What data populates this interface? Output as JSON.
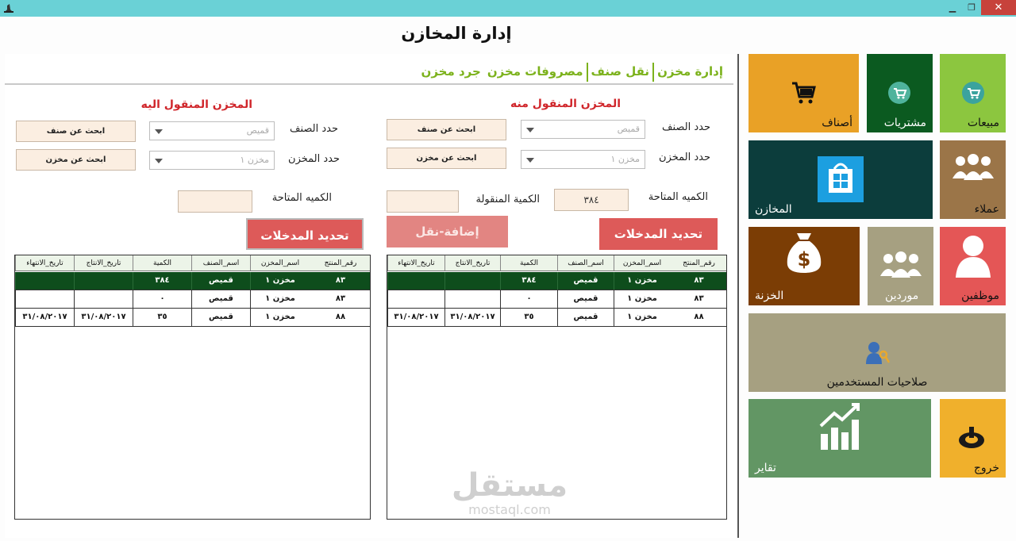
{
  "window": {
    "title_icon": "witch-hat-icon",
    "minimize": "▁",
    "maximize": "❐",
    "close": "✕"
  },
  "page": {
    "title": "إدارة المخازن"
  },
  "tabs": [
    "إدارة مخزن",
    "نقل صنف",
    "مصروفات مخزن",
    "جرد مخزن"
  ],
  "from_section": {
    "heading": "المخزن المنقول منه",
    "item_label": "حدد الصنف",
    "item_value": "قميص",
    "item_search": "ابحث عن صنف",
    "store_label": "حدد المخزن",
    "store_value": "مخزن ١",
    "store_search": "ابحث عن مخزن",
    "available_label": "الكميه المتاحة",
    "available_value": "٣٨٤",
    "moved_label": "الكمية المنقولة",
    "moved_value": "",
    "add_button": "إضافة-نقل",
    "refresh_button": "تحديد المدخلات"
  },
  "to_section": {
    "heading": "المخزن المنقول اليه",
    "item_label": "حدد الصنف",
    "item_value": "قميص",
    "item_search": "ابحث عن صنف",
    "store_label": "حدد المخزن",
    "store_value": "مخزن ١",
    "store_search": "ابحث عن مخزن",
    "available_label": "الكميه المتاحة",
    "available_value": "",
    "refresh_button": "تحديد المدخلات"
  },
  "grid_columns": [
    "رقم_المنتج",
    "اسم_المخزن",
    "اسم_الصنف",
    "الكمية",
    "تاريخ_الانتاج",
    "تاريخ_الانتهاء"
  ],
  "from_grid": {
    "rows": [
      [
        "٨٣",
        "مخزن ١",
        "قميص",
        "٣٨٤",
        "",
        ""
      ],
      [
        "٨٣",
        "مخزن ١",
        "قميص",
        "٠",
        "",
        ""
      ],
      [
        "٨٨",
        "مخزن ١",
        "قميص",
        "٣٥",
        "٣١/٠٨/٢٠١٧",
        "٣١/٠٨/٢٠١٧"
      ]
    ]
  },
  "to_grid": {
    "rows": [
      [
        "٨٣",
        "مخزن ١",
        "قميص",
        "٣٨٤",
        "",
        ""
      ],
      [
        "٨٣",
        "مخزن ١",
        "قميص",
        "٠",
        "",
        ""
      ],
      [
        "٨٨",
        "مخزن ١",
        "قميص",
        "٣٥",
        "٣١/٠٨/٢٠١٧",
        "٣١/٠٨/٢٠١٧"
      ]
    ]
  },
  "tiles": {
    "sales": {
      "label": "مبيعات",
      "icon": "cart-circle-icon",
      "color": "#8cc63f"
    },
    "purchases": {
      "label": "مشتريات",
      "icon": "cart-circle-icon",
      "color": "#0b5a20"
    },
    "items": {
      "label": "أصناف",
      "icon": "shopping-cart-icon",
      "color": "#e9a126"
    },
    "customers": {
      "label": "عملاء",
      "icon": "users-icon",
      "color": "#9b7548"
    },
    "stores": {
      "label": "المخازن",
      "icon": "store-bag-icon",
      "color": "#0c3d3c"
    },
    "employees": {
      "label": "موظفين",
      "icon": "person-icon",
      "color": "#e45656"
    },
    "suppliers": {
      "label": "موردين",
      "icon": "users-icon",
      "color": "#a6a081"
    },
    "treasury": {
      "label": "الخزنة",
      "icon": "money-bag-icon",
      "color": "#7b3d05"
    },
    "permissions": {
      "label": "صلاحيات المستخدمين",
      "icon": "user-key-icon",
      "color": "#a6a081"
    },
    "exit": {
      "label": "خروج",
      "icon": "power-icon",
      "color": "#f0b02c"
    },
    "reports": {
      "label": "تقاير",
      "icon": "chart-up-icon",
      "color": "#629664"
    }
  },
  "watermark": {
    "brand": "مستقل",
    "domain": "mostaql.com"
  }
}
